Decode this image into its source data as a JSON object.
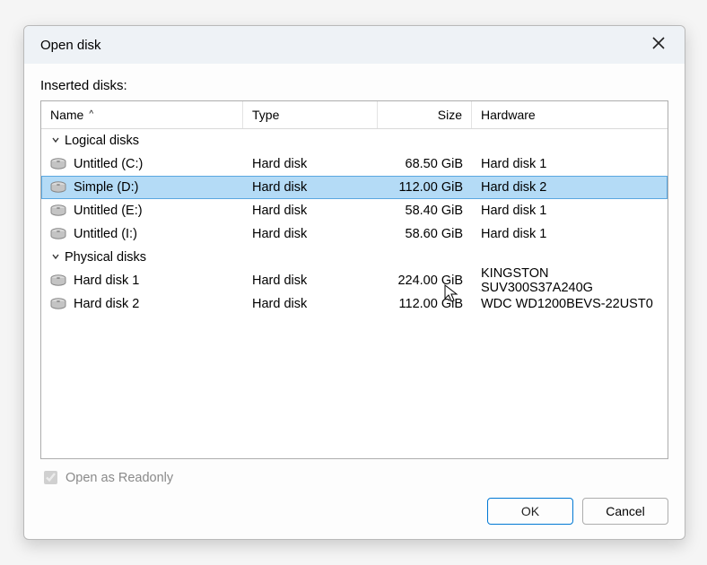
{
  "dialog": {
    "title": "Open disk",
    "section_label": "Inserted disks:",
    "columns": {
      "name": "Name",
      "type": "Type",
      "size": "Size",
      "hardware": "Hardware"
    },
    "sort_indicator": "^",
    "groups": [
      {
        "label": "Logical disks",
        "items": [
          {
            "name": "Untitled (C:)",
            "type": "Hard disk",
            "size": "68.50 GiB",
            "hardware": "Hard disk 1",
            "selected": false
          },
          {
            "name": "Simple (D:)",
            "type": "Hard disk",
            "size": "112.00 GiB",
            "hardware": "Hard disk 2",
            "selected": true
          },
          {
            "name": "Untitled (E:)",
            "type": "Hard disk",
            "size": "58.40 GiB",
            "hardware": "Hard disk 1",
            "selected": false
          },
          {
            "name": "Untitled (I:)",
            "type": "Hard disk",
            "size": "58.60 GiB",
            "hardware": "Hard disk 1",
            "selected": false
          }
        ]
      },
      {
        "label": "Physical disks",
        "items": [
          {
            "name": "Hard disk 1",
            "type": "Hard disk",
            "size": "224.00 GiB",
            "hardware": "KINGSTON SUV300S37A240G",
            "selected": false
          },
          {
            "name": "Hard disk 2",
            "type": "Hard disk",
            "size": "112.00 GiB",
            "hardware": "WDC WD1200BEVS-22UST0",
            "selected": false
          }
        ]
      }
    ],
    "readonly": {
      "label": "Open as Readonly",
      "checked": true,
      "disabled": true
    },
    "buttons": {
      "ok": "OK",
      "cancel": "Cancel"
    }
  }
}
